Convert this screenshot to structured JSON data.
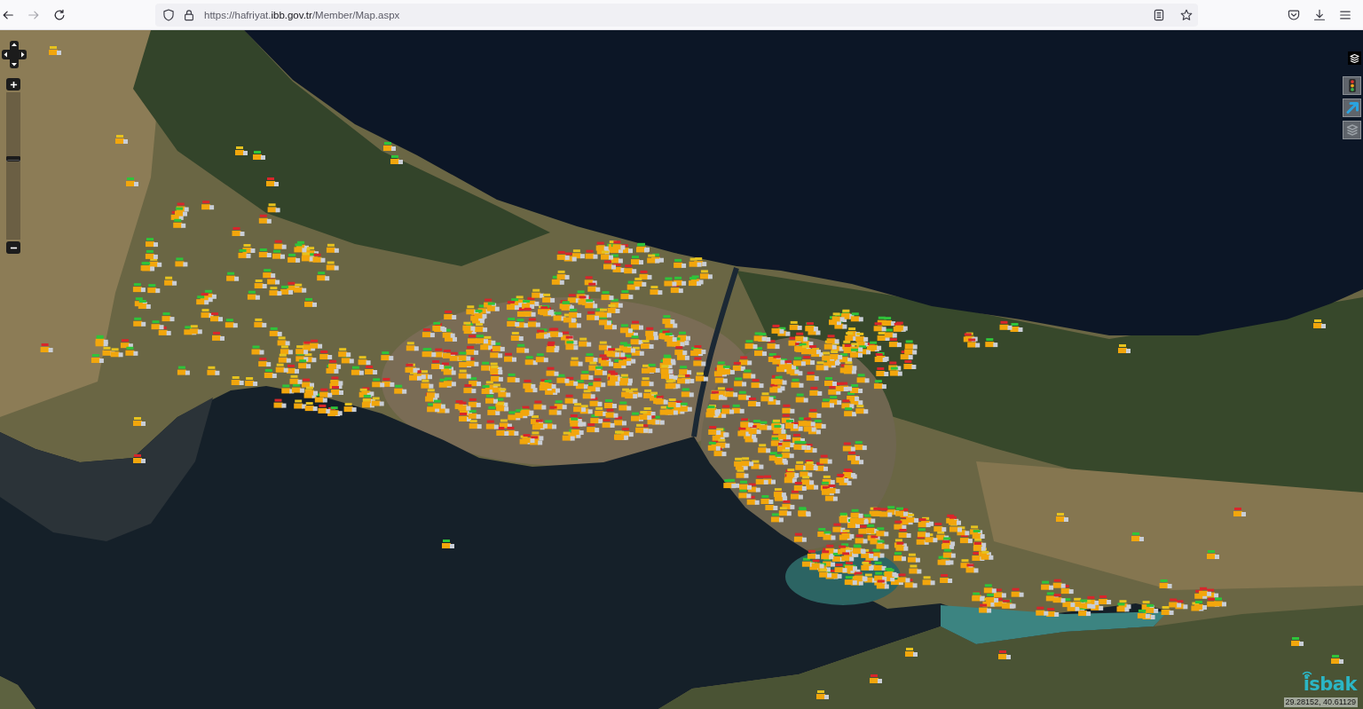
{
  "browser": {
    "nav_buttons": [
      {
        "kind": "back",
        "disabled": false
      },
      {
        "kind": "forward",
        "disabled": true
      },
      {
        "kind": "reload",
        "disabled": false
      }
    ],
    "address_bar": {
      "url_start": "https://hafriyat.",
      "url_domain": "ibb.gov.tr",
      "url_end": "/Member/Map.aspx"
    }
  },
  "map": {
    "zoom_slider": {
      "level": 0.55
    },
    "logo": "isbak",
    "coordinates": "29.28152, 40.61129"
  }
}
